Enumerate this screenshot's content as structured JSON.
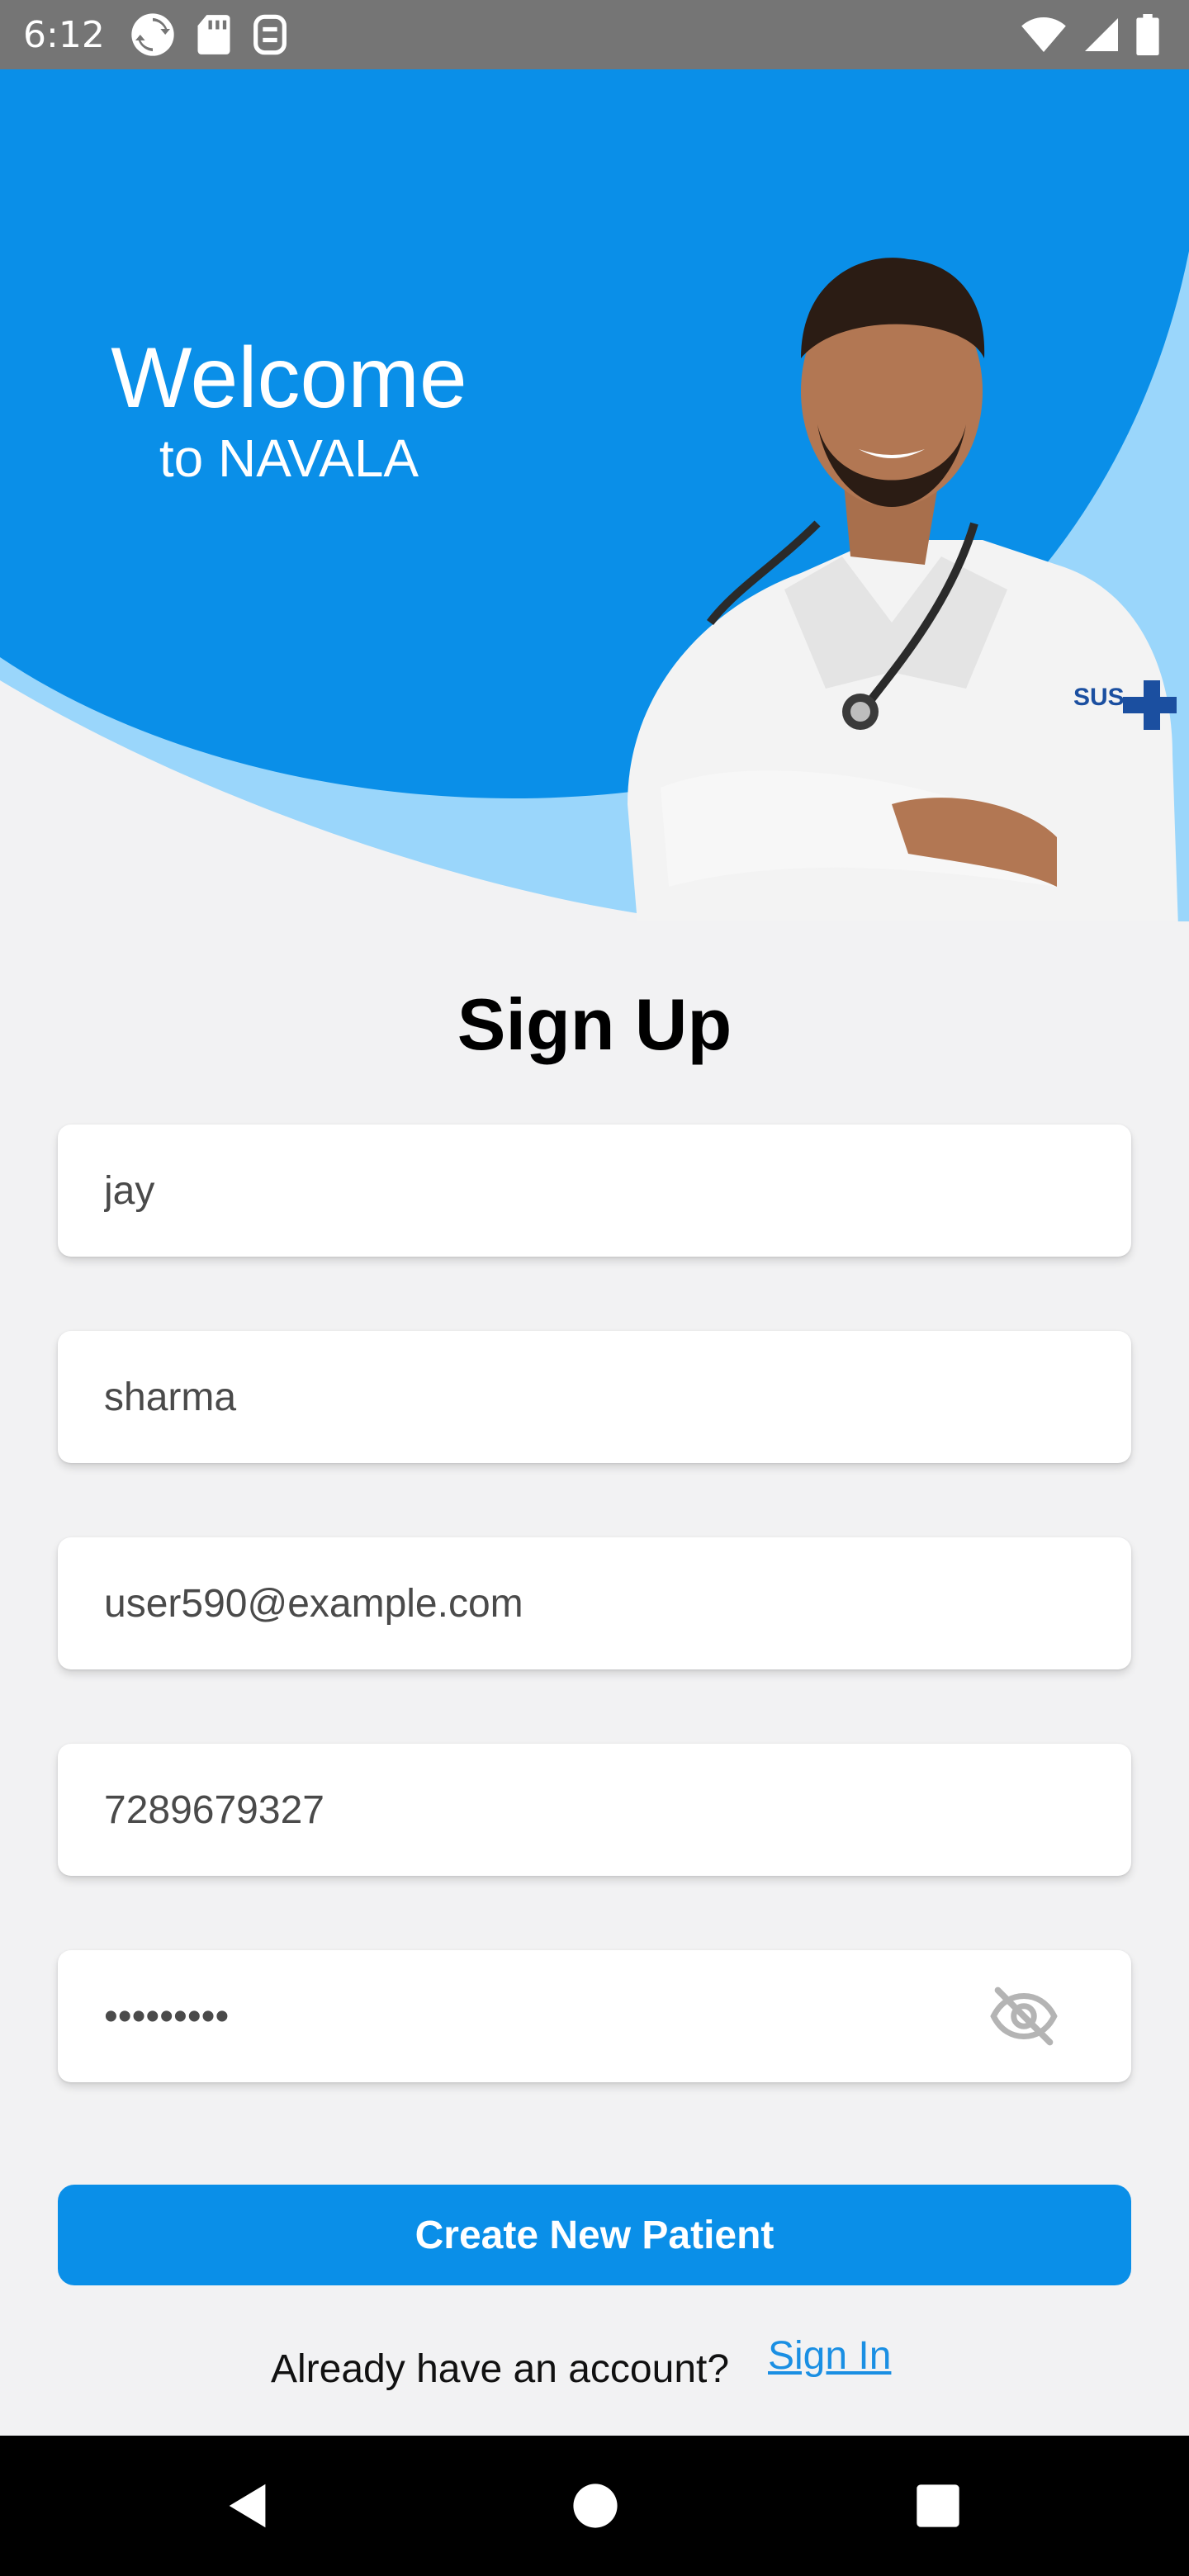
{
  "status_bar": {
    "time": "6:12",
    "left_icons": [
      "sync-icon",
      "sd-card-icon",
      "storage-icon"
    ],
    "right_icons": [
      "wifi-icon",
      "cell-signal-icon",
      "battery-icon"
    ]
  },
  "hero": {
    "welcome_title": "Welcome",
    "welcome_subtitle": "to NAVALA",
    "colors": {
      "primary": "#0a8fe8",
      "light": "#9ad6fb"
    }
  },
  "form": {
    "title": "Sign Up",
    "first_name": {
      "value": "jay"
    },
    "last_name": {
      "value": "sharma"
    },
    "email": {
      "value": "user590@example.com"
    },
    "phone": {
      "value": "7289679327"
    },
    "password": {
      "value": "•••••••••",
      "toggle_icon": "eye-off-icon"
    },
    "submit_label": "Create New Patient",
    "signin_prompt": "Already have an account?",
    "signin_link": "Sign In"
  },
  "nav_bar": {
    "buttons": [
      "back-icon",
      "home-icon",
      "recents-icon"
    ]
  }
}
